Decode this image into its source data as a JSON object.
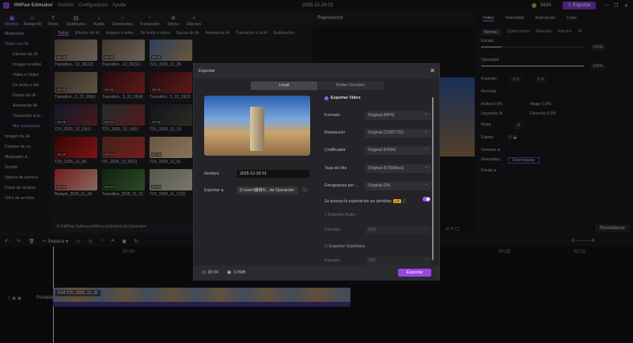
{
  "app": {
    "title": "HitPaw Edimakor",
    "menu": [
      "Archivo",
      "Configuración",
      "Ayuda"
    ],
    "project": "2025-12-29 01",
    "credits": "5634",
    "export_label": "Exportar"
  },
  "toolbar": [
    {
      "label": "Medios",
      "icon": "media-icon"
    },
    {
      "label": "Avatar AI",
      "icon": "avatar-icon"
    },
    {
      "label": "Texto",
      "icon": "text-icon"
    },
    {
      "label": "Subtítulos",
      "icon": "subtitle-icon"
    },
    {
      "label": "Audio",
      "icon": "audio-icon"
    },
    {
      "label": "Elementos",
      "icon": "elements-icon"
    },
    {
      "label": "Transición",
      "icon": "transition-icon"
    },
    {
      "label": "Filtros",
      "icon": "filter-icon"
    },
    {
      "label": "Efectos",
      "icon": "effects-icon"
    }
  ],
  "sidebar": {
    "items": [
      {
        "label": "Materiales",
        "type": "group"
      },
      {
        "label": "Video con IA",
        "type": "group",
        "active": true
      },
      {
        "label": "Efectos de IA",
        "type": "sub"
      },
      {
        "label": "Imagen a video",
        "type": "sub"
      },
      {
        "label": "Video a Video",
        "type": "sub"
      },
      {
        "label": "De texto a vid...",
        "type": "sub"
      },
      {
        "label": "Danza de IA",
        "type": "sub"
      },
      {
        "label": "Animación IA",
        "type": "sub"
      },
      {
        "label": "Transición a la...",
        "type": "sub"
      },
      {
        "label": "Mis creaciones",
        "type": "sub",
        "active": true
      },
      {
        "label": "Imagen de IA",
        "type": "group"
      },
      {
        "label": "Cambio de ro...",
        "type": "group"
      },
      {
        "label": "Mejorador d...",
        "type": "group"
      },
      {
        "label": "Sonido",
        "type": "group"
      },
      {
        "label": "Videos de archivo",
        "type": "group"
      },
      {
        "label": "Fotos de archivo",
        "type": "group"
      },
      {
        "label": "GIFs de archivo",
        "type": "group"
      }
    ]
  },
  "media": {
    "categories": [
      "Todos",
      "Efectos de IA",
      "Imagen a video",
      "De texto a video",
      "Danza de IA",
      "Animación IA",
      "Transición a la IA",
      "Estilización"
    ],
    "items": [
      {
        "name": "Transition...12_26(12)",
        "duration": "00:05",
        "colors": [
          "#6a5a4a",
          "#b0a090"
        ]
      },
      {
        "name": "Transition...12_26(11)",
        "duration": "00:05",
        "colors": [
          "#6a5a4a",
          "#b0a090"
        ]
      },
      {
        "name": "T2V_2025_12_26",
        "duration": "00:05",
        "colors": [
          "#4a6a9a",
          "#b09060"
        ]
      },
      {
        "name": "Transition...3_12_20(6)",
        "duration": "00:05",
        "colors": [
          "#5a4a3a",
          "#9a8a70"
        ]
      },
      {
        "name": "Transition...3_12_19(4)",
        "duration": "00:04",
        "colors": [
          "#3a1416",
          "#a02a2a"
        ]
      },
      {
        "name": "Transition...3_12_19(2)",
        "duration": "00:05",
        "colors": [
          "#3a1416",
          "#a02a2a"
        ]
      },
      {
        "name": "T2V_2025_12_19(1)",
        "duration": "00:05",
        "colors": [
          "#1a2a4a",
          "#7a2a2a"
        ]
      },
      {
        "name": "T2V_2025_12_19(1)",
        "duration": "00:04",
        "colors": [
          "#3a4a4a",
          "#8a2a2a"
        ]
      },
      {
        "name": "T2V_2025_12_19",
        "duration": "00:05",
        "colors": [
          "#1a2030",
          "#4a4a3a"
        ]
      },
      {
        "name": "T2V_2025_12_04",
        "duration": "00:05",
        "colors": [
          "#5a0a0a",
          "#d02020"
        ]
      },
      {
        "name": "I2V_2025_12_02(1)",
        "duration": "00:04",
        "colors": [
          "#6a3a2a",
          "#c03030"
        ]
      },
      {
        "name": "T2V_2025_12_01",
        "duration": "00:05",
        "colors": [
          "#b09070",
          "#e0c090"
        ]
      },
      {
        "name": "Restyle_2025_11_28",
        "duration": "00:05",
        "colors": [
          "#c03030",
          "#e0b0a0"
        ]
      },
      {
        "name": "Transition_2025_11_21",
        "duration": "00:05",
        "colors": [
          "#1a3a1a",
          "#4a7a3a"
        ]
      },
      {
        "name": "T2V_2025_11_17(2)",
        "duration": "00:05",
        "colors": [
          "#8a9a7a",
          "#d0c0b0"
        ]
      }
    ],
    "path": "D:/HitPaw Software/HitPaw Edimakor/AI Generator"
  },
  "player": {
    "title": "Reproductor"
  },
  "properties": {
    "tabs": [
      "Vídeo",
      "Velocidad",
      "Animación",
      "Color"
    ],
    "subtabs": [
      "Normal",
      "Quitar fondo",
      "Máscara",
      "Efectos",
      "AI"
    ],
    "scale_label": "Escala",
    "scale_value": "100%",
    "scale_level": 0.2,
    "opacity_label": "Opacidad",
    "opacity_value": "100%",
    "opacity_level": 1.0,
    "position_label": "Posición",
    "pos_x": "0",
    "pos_y": "0",
    "crop_label": "Recortar",
    "crop_top": "Arriba",
    "crop_top_v": "0.0%",
    "crop_bottom": "Abajo",
    "crop_bottom_v": "0.0%",
    "crop_left": "Izquierdo",
    "crop_left_v": "%",
    "crop_right": "Derecho",
    "crop_right_v": "0.0%",
    "rotate_label": "Rotar",
    "rotate_v": "0",
    "mirror_label": "Espejo",
    "reverse_label": "Reverso",
    "replace_label": "Reemplaz...",
    "replace_btn": "Reemplazar",
    "background_label": "Fondo",
    "reset_label": "Restablecer"
  },
  "timeline": {
    "split_label": "Separar",
    "track_label": "Portada",
    "clip_label": "0:04  T2V_2025_12_26",
    "ruler": [
      "00:00",
      "00:05",
      "00:10"
    ]
  },
  "dialog": {
    "title": "Exportar",
    "tabs": [
      "Local",
      "Redes Sociales"
    ],
    "name_label": "Nombre",
    "name_value": "2025-12-29 01",
    "exportto_label": "Exportar a",
    "exportto_value": "D:/user/编辑/E...de Operación",
    "export_video": "Exportar Video",
    "settings": [
      {
        "label": "Formato",
        "value": "Original (MP4)"
      },
      {
        "label": "Resolución",
        "value": "Original (1280*720)"
      },
      {
        "label": "Codificador",
        "value": "Original (H264)"
      },
      {
        "label": "Tasa de bits",
        "value": "Original (6760kbps)"
      },
      {
        "label": "Fotogramas por ...",
        "value": "Original (24)"
      }
    ],
    "lossless_label": "Se prioriza la exportación sin pérdidas",
    "vip": "VIP",
    "lossless_on": true,
    "export_audio": "Exportar Audio",
    "audio_format_label": "Formato",
    "audio_format": "MP3",
    "export_subtitles": "Exportar Subtítulos",
    "sub_format_label": "Formato",
    "sub_format": "SRT",
    "duration": "00:04",
    "size": "3.0MB",
    "export_button": "Exportar",
    "accent": "#9a44e6"
  }
}
